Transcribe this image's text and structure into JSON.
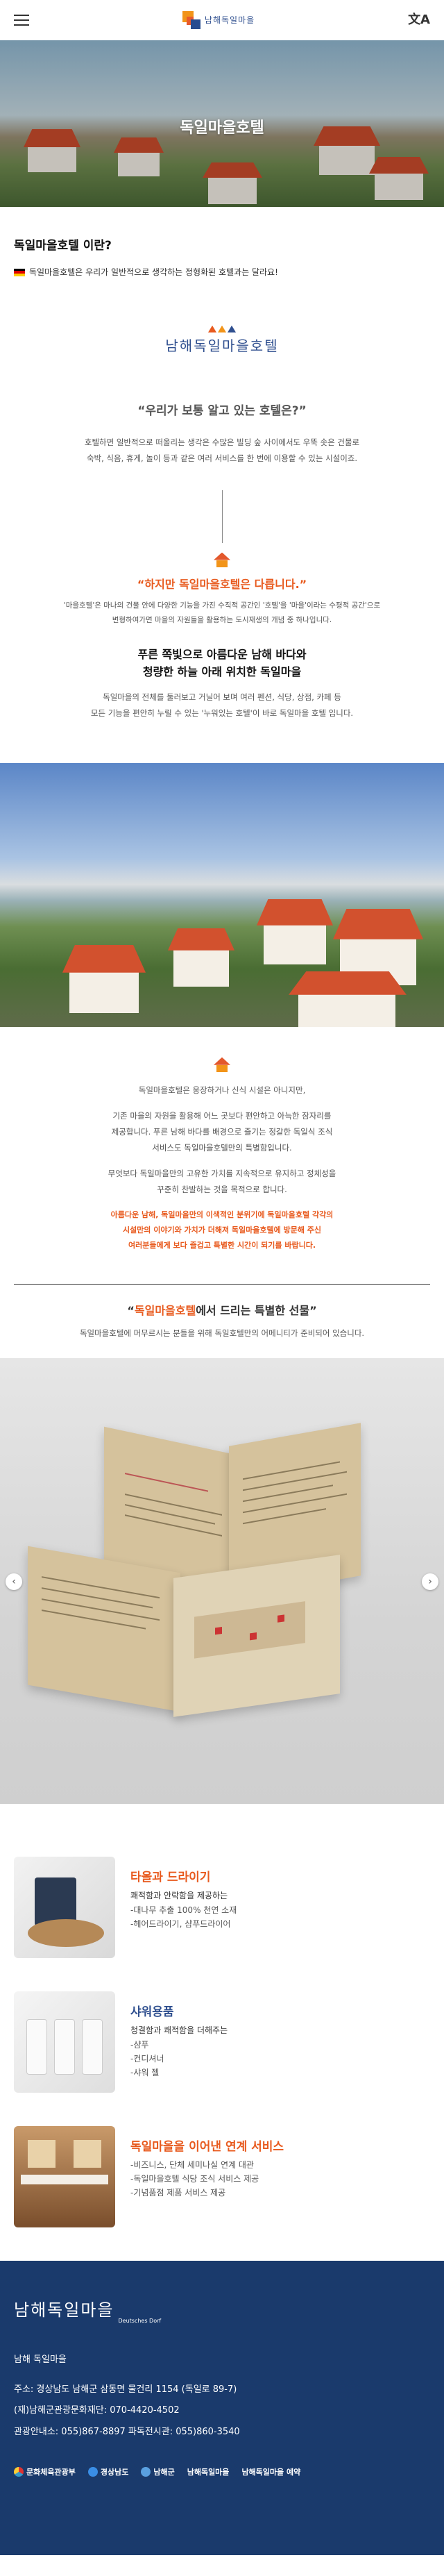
{
  "header": {
    "logo_text": "남해독일마을",
    "translate_icon": "文A"
  },
  "hero": {
    "title": "독일마을호텔"
  },
  "intro": {
    "title": "독일마을호텔 이란?",
    "subtitle": "독일마을호텔은 우리가 일반적으로 생각하는 정형화된 호텔과는 달라요!"
  },
  "brand_logo": "남해독일마을호텔",
  "quote1": {
    "heading": "“우리가 보통 알고 있는 호텔은?”",
    "lines": [
      "호텔하면 일반적으로 떠올리는 생각은 수많은 빌딩 숲 사이에서도 우뚝 솟은 건물로",
      "숙박, 식음, 휴게, 놀이 등과 같은 여러 서비스를 한 번에 이용할 수 있는 시설이죠."
    ]
  },
  "quote2": {
    "heading": "“하지만 독일마을호텔은 다릅니다.”",
    "lines": [
      "'마을호텔'은 마나의 건물 안에 다양한 기능을 가진 수직적 공간인 '호텔'을 '마을'이라는 수평적 공간'으로",
      "변형하여가면 마을의 자원들을 활용하는 도시재생의 개념 중 하나입니다."
    ]
  },
  "section_title": [
    "푸른 쪽빛으로 아름다운 남해 바다와",
    "청량한 하늘 아래 위치한 독일마을"
  ],
  "section_desc": [
    "독일마을의 전체를 둘러보고 거닐어 보며 여러 펜션, 식당, 상점, 카페 등",
    "모든 기능을 편안히 누릴 수 있는 '누워있는 호텔'이 바로 독일마을 호텔 입니다."
  ],
  "sec3": {
    "p1": "독일마을호텔은 웅장하거나 신식 시설은 아니지만,",
    "p2": [
      "기존 마을의 자원을 활용해 어느 곳보다 편안하고 아늑한 잠자리를",
      "제공합니다. 푸른 남해 바다를 배경으로 즐기는 정갈한 독일식 조식",
      "서비스도 독일마을호텔만의 특별함입니다."
    ],
    "p3": [
      "무엇보다 독일마을만의 고유한 가치를 지속적으로 유지하고 정체성을",
      "꾸준히 찬발하는 것을 목적으로 합니다."
    ],
    "highlight": [
      "아름다운 남해, 독일마을만의 이색적인 분위기에 독일마을호텔 각각의",
      "시설만의 이야기와 가치가 더해져 독일마을호텔에 방문해 주신",
      "여러분들에게 보다 즐겁고 특별한 시간이 되기를 바랍니다."
    ]
  },
  "gift_section": {
    "title_orange": "독일마을호텔",
    "title_rest": "에서 드리는 특별한 선물",
    "title_open": "“",
    "title_close": "”",
    "note": "독일마을호텔에 머무르시는 분들을 위해 독일호텔만의 어메니티가 준비되어 있습니다."
  },
  "gifts": [
    {
      "title": "타올과 드라이기",
      "title_color": "#e85a1e",
      "lead": "쾌적함과 안락함을 제공하는",
      "items": [
        "-대나무 추출 100% 천연 소재",
        "-헤어드라이기, 샴푸드라이어"
      ]
    },
    {
      "title": "샤워용품",
      "title_color": "#2f4f8f",
      "lead": "청결함과 쾌적함을 더해주는",
      "items": [
        "-샴푸",
        "-컨디셔너",
        "-샤워 젤"
      ]
    },
    {
      "title": "독일마을을 이어낸 연계 서비스",
      "title_color": "#e85a1e",
      "lead": "",
      "items": [
        "-비즈니스, 단체 세미나실 연계 대관",
        "-독일마을호텔 식당 조식 서비스 제공",
        "-기념품점 제품 서비스 제공"
      ]
    }
  ],
  "footer": {
    "logo": "남해독일마을",
    "logo_sub": "Deutsches Dorf",
    "name": "남해 독일마을",
    "address": "주소: 경상남도 남해군 삼동면 물건리 1154 (독일로 89-7)",
    "phone": "(재)남해군관광문화재단: 070-4420-4502",
    "contact": "관광안내소: 055)867-8897  파독전시관: 055)860-3540",
    "partners": [
      "문화체육관광부",
      "경상남도",
      "남해군",
      "남해독일마을",
      "남해독일마을 예약"
    ]
  },
  "colors": {
    "accent": "#e85a1e",
    "brand_blue": "#2f4f8f",
    "footer_bg": "#1a3a6c"
  }
}
